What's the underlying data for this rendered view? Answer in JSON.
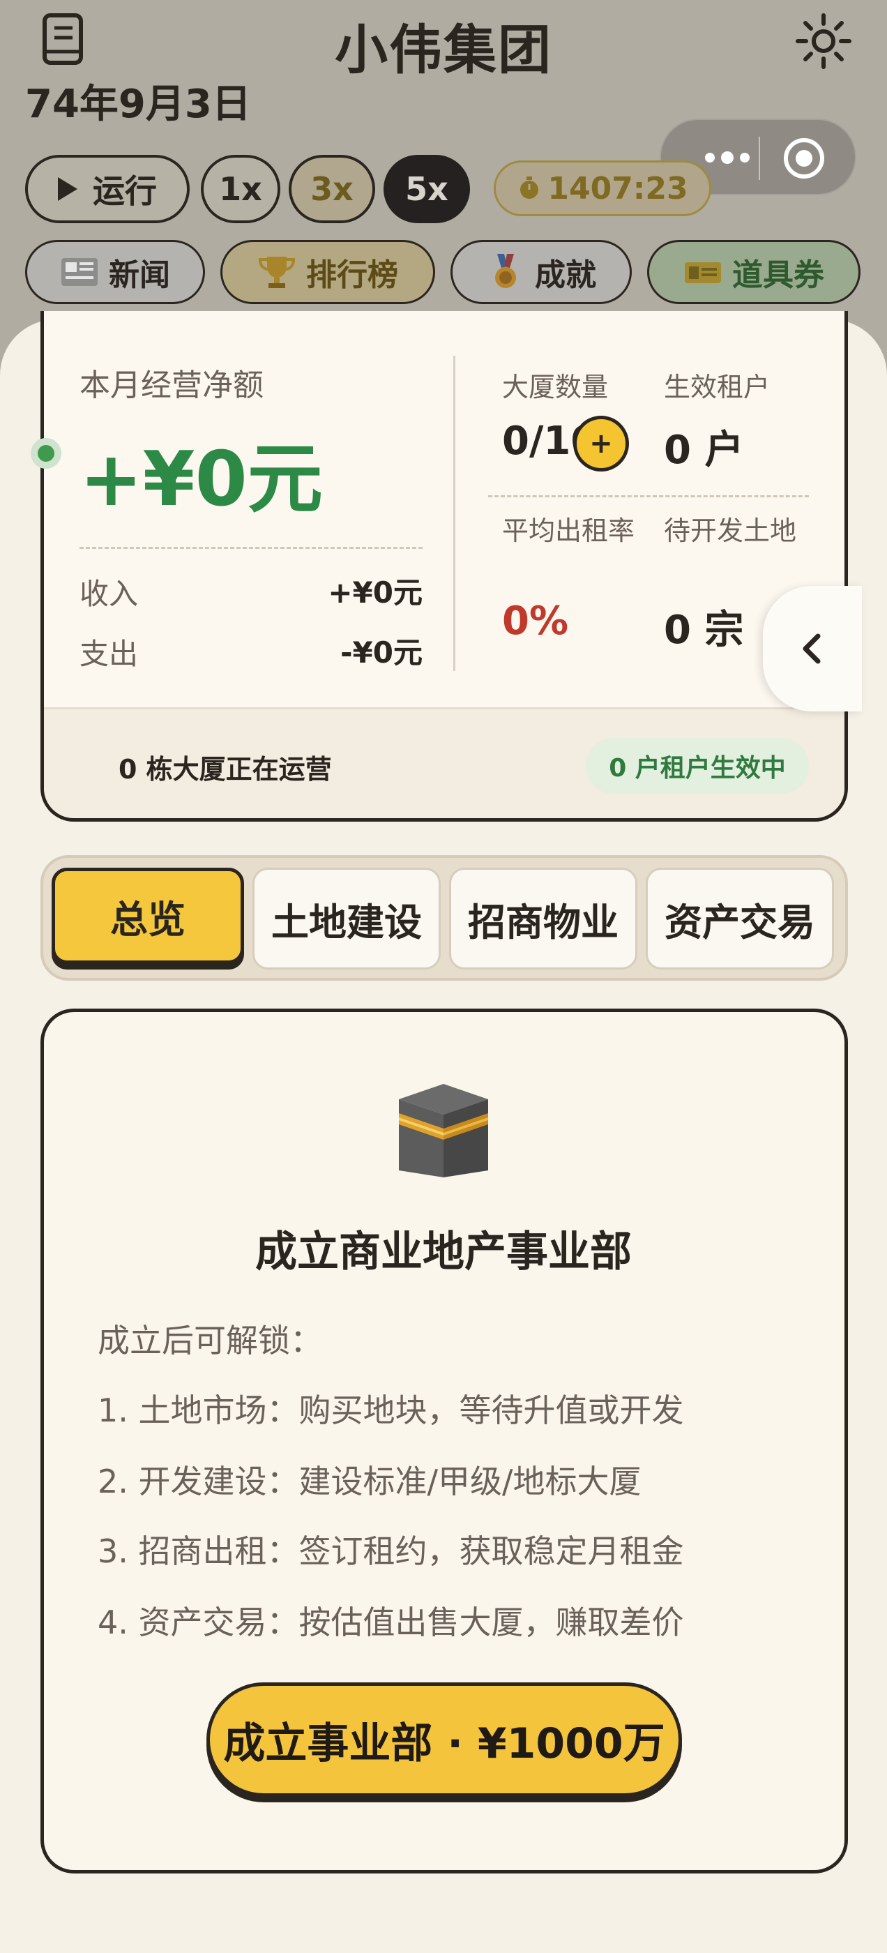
{
  "header": {
    "title": "小伟集团",
    "date": "74年9月3日",
    "left_icon": "book-icon",
    "right_icon": "gear-icon"
  },
  "miniprogram_capsule": {
    "menu_icon": "more-dots-icon",
    "close_icon": "target-icon"
  },
  "controls": {
    "run_label": "运行",
    "speeds": [
      "1x",
      "3x",
      "5x"
    ],
    "selected_speed": "5x",
    "timer": "1407:23"
  },
  "nav": {
    "news": "新闻",
    "leaderboard": "排行榜",
    "achievements": "成就",
    "coupons": "道具券"
  },
  "summary": {
    "net_label": "本月经营净额",
    "net_value": "+¥0元",
    "income_label": "收入",
    "income_value": "+¥0元",
    "expense_label": "支出",
    "expense_value": "-¥0元",
    "buildings_label": "大厦数量",
    "buildings_value": "0/10",
    "tenants_label": "生效租户",
    "tenants_value": "0 户",
    "occupancy_label": "平均出租率",
    "occupancy_value": "0%",
    "land_label": "待开发土地",
    "land_value": "0 宗",
    "operating_text": "0 栋大厦正在运营",
    "tenant_badge": "0 户租户生效中",
    "plus_symbol": "+"
  },
  "tabs": [
    "总览",
    "土地建设",
    "招商物业",
    "资产交易"
  ],
  "active_tab": "总览",
  "feature": {
    "icon": "kaaba-building-icon",
    "title": "成立商业地产事业部",
    "intro": "成立后可解锁：",
    "items": [
      "1. 土地市场：购买地块，等待升值或开发",
      "2. 开发建设：建设标准/甲级/地标大厦",
      "3. 招商出租：签订租约，获取稳定月租金",
      "4. 资产交易：按估值出售大厦，赚取差价"
    ],
    "cta": "成立事业部 · ¥1000万"
  },
  "colors": {
    "accent_yellow": "#f4c43c",
    "profit_green": "#2c8a46",
    "alert_red": "#c0392b",
    "dark": "#2b2520"
  }
}
